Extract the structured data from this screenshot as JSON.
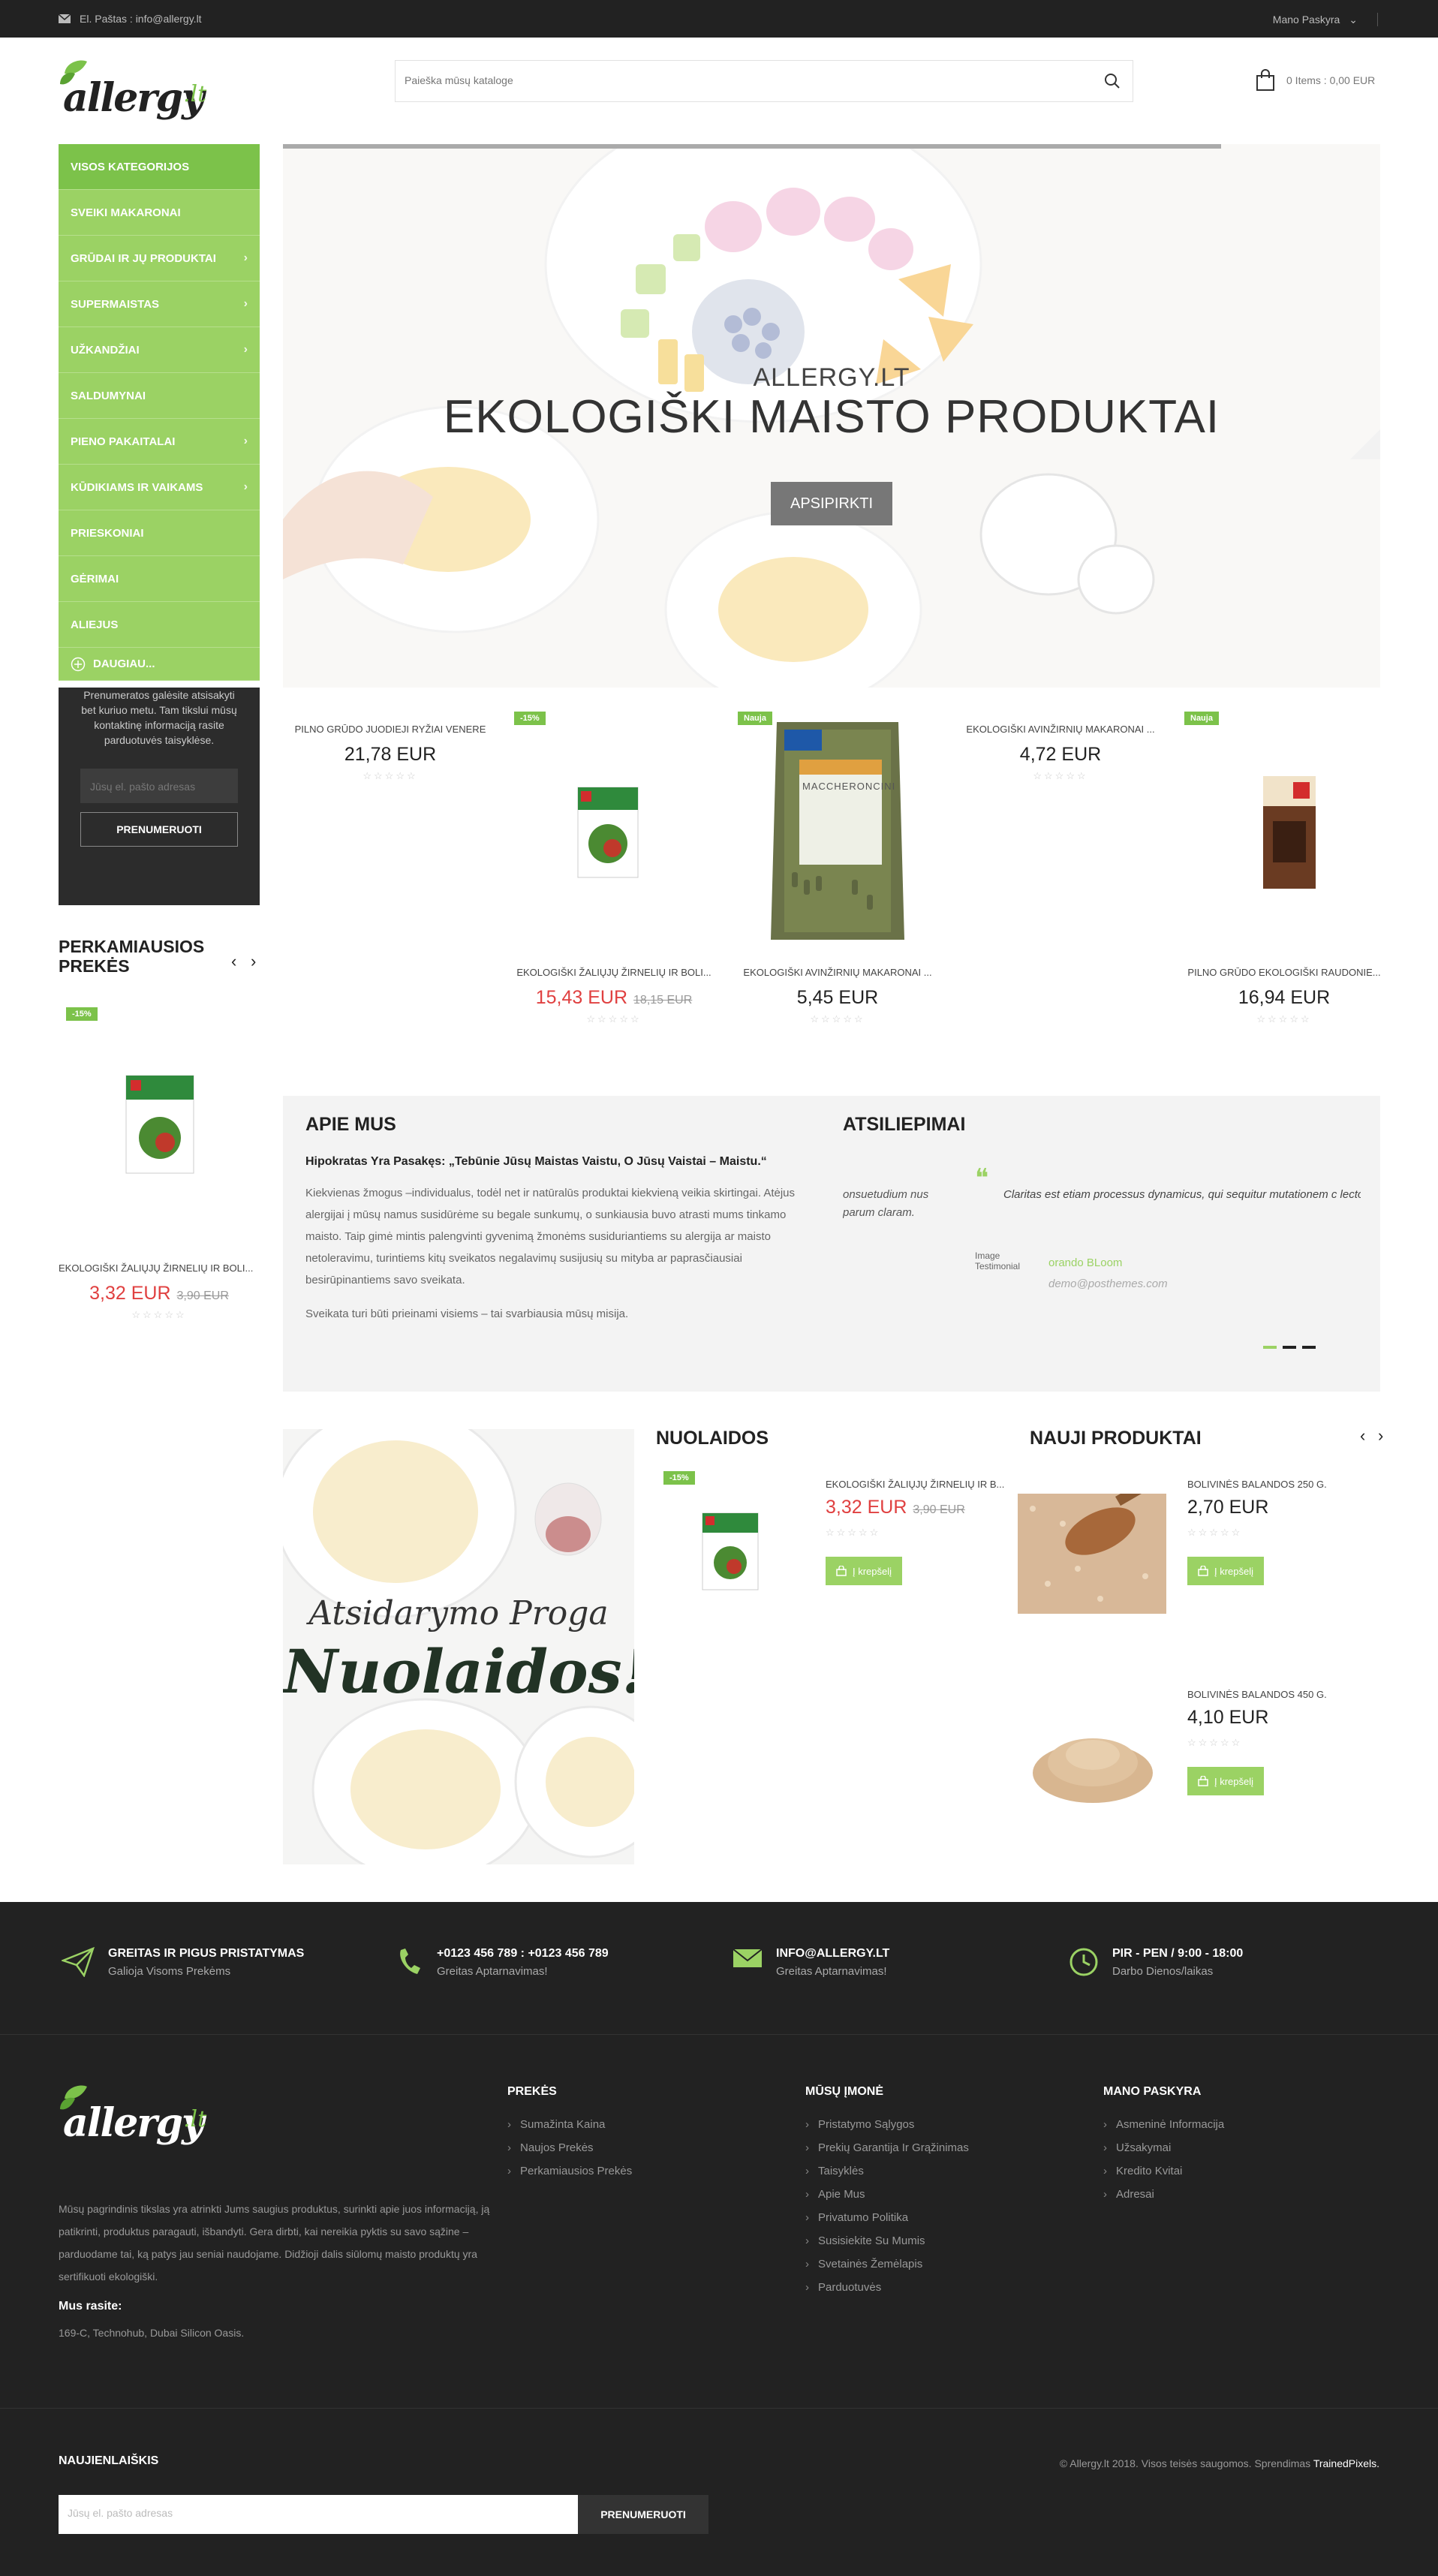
{
  "topbar": {
    "email": "El. Paštas : info@allergy.lt",
    "account": "Mano Paskyra"
  },
  "header": {
    "logo_text": "allergy",
    "logo_tld": ".lt",
    "search_placeholder": "Paieška mūsų kataloge",
    "cart": "0 Items : 0,00 EUR"
  },
  "categories": [
    "Visos kategorijos",
    "Sveiki makaronai",
    "Grūdai ir jų produktai",
    "Supermaistas",
    "Užkandžiai",
    "Saldumynai",
    "Pieno pakaitalai",
    "Kūdikiams ir vaikams",
    "Prieskoniai",
    "Gėrimai",
    "Aliejus"
  ],
  "categories_more": "Daugiau...",
  "newsletter_side": {
    "text": "Prenumeratos galėsite atsisakyti bet kuriuo metu. Tam tikslui mūsų kontaktinę informaciją rasite parduotuvės taisyklėse.",
    "placeholder": "Jūsų el. pašto adresas",
    "button": "Prenumeruoti"
  },
  "hero": {
    "subtitle": "ALLERGY.LT",
    "title": "EKOLOGIŠKI MAISTO PRODUKTAI",
    "button": "APSIPIRKTI"
  },
  "products_row": [
    {
      "name": "Pilno grūdo juodieji ryžiai Venere",
      "price": "21,78 EUR",
      "badge": "",
      "old": ""
    },
    {
      "name": "Ekologiški žaliųjų žirnelių ir boli...",
      "price": "15,43 EUR",
      "badge": "-15%",
      "old": "18,15 EUR"
    },
    {
      "name": "Ekologiški avinžirnių makaronai ...",
      "price": "5,45 EUR",
      "badge": "Nauja",
      "old": ""
    },
    {
      "name": "Ekologiški avinžirnių makaronai ...",
      "price": "4,72 EUR",
      "badge": "",
      "old": ""
    },
    {
      "name": "Pilno grūdo ekologiški raudonie...",
      "price": "16,94 EUR",
      "badge": "Nauja",
      "old": ""
    }
  ],
  "pack_text": "MACCHERONCINI",
  "best": {
    "title": "PERKAMIAUSIOS PREKĖS",
    "badge": "-15%",
    "name": "Ekologiški žaliųjų žirnelių ir boli...",
    "price": "3,32 EUR",
    "old": "3,90 EUR"
  },
  "about": {
    "title": "APIE MUS",
    "quote": "Hipokratas Yra Pasakęs: „Tebūnie Jūsų Maistas Vaistu, O Jūsų Vaistai – Maistu.“",
    "p1": "Kiekvienas žmogus –individualus, todėl net ir natūralūs produktai kiekvieną veikia skirtingai. Atėjus alergijai į mūsų namus susidūrėme su begale sunkumų, o sunkiausia buvo atrasti mums tinkamo maisto.  Taip gimė mintis palengvinti gyvenimą žmonėms susiduriantiems su alergija ar maisto netoleravimu, turintiems kitų sveikatos negalavimų susijusių su mityba ar paprasčiausiai besirūpinantiems savo sveikata.",
    "p2": "Sveikata turi būti prieinami visiems – tai svarbiausia mūsų misija."
  },
  "testimonials": {
    "title": "ATSILIEPIMAI",
    "left_text": "onsuetudium nus parum claram.",
    "text": "Claritas est etiam processus dynamicus, qui sequitur mutationem c lectorum. Mirum est notare quam littera gothica, quam nunc putar",
    "image_alt": "Image Testimonial",
    "author": "orando BLoom",
    "email": "demo@posthemes.com"
  },
  "promo": {
    "line1": "Atsidarymo Proga",
    "line2": "Nuolaidos!"
  },
  "discounts": {
    "title": "NUOLAIDOS",
    "badge": "-15%",
    "name": "Ekologiški žaliųjų žirnelių ir b...",
    "price": "3,32 EUR",
    "old": "3,90 EUR",
    "button": "Į krepšelį"
  },
  "new_products": {
    "title": "NAUJI PRODUKTAI",
    "items": [
      {
        "name": "Bolivinės balandos 250 g.",
        "price": "2,70 EUR",
        "button": "Į krepšelį"
      },
      {
        "name": "Bolivinės balandos 450 g.",
        "price": "4,10 EUR",
        "button": "Į krepšelį"
      }
    ]
  },
  "features": [
    {
      "icon": "paper-plane-icon",
      "title": "GREITAS IR PIGUS PRISTATYMAS",
      "text": "Galioja Visoms Prekėms"
    },
    {
      "icon": "phone-icon",
      "title": "+0123 456 789 : +0123 456 789",
      "text": "Greitas Aptarnavimas!"
    },
    {
      "icon": "envelope-icon",
      "title": "INFO@ALLERGY.LT",
      "text": "Greitas Aptarnavimas!"
    },
    {
      "icon": "clock-icon",
      "title": "PIR - PEN / 9:00 - 18:00",
      "text": "Darbo Dienos/laikas"
    }
  ],
  "footer": {
    "about": "Mūsų pagrindinis tikslas yra atrinkti Jums saugius produktus, surinkti apie juos informaciją, ją patikrinti, produktus paragauti, išbandyti. Gera dirbti, kai nereikia pyktis su savo sąžine – parduodame tai, ką patys jau seniai naudojame. Didžioji dalis siūlomų maisto produktų yra sertifikuoti ekologiški.",
    "find_us": "Mus rasite:",
    "address": "169-C, Technohub, Dubai Silicon Oasis.",
    "cols": [
      {
        "title": "PREKĖS",
        "items": [
          "Sumažinta Kaina",
          "Naujos Prekės",
          "Perkamiausios Prekės"
        ]
      },
      {
        "title": "MŪSŲ ĮMONĖ",
        "items": [
          "Pristatymo Sąlygos",
          "Prekių Garantija Ir Grąžinimas",
          "Taisyklės",
          "Apie Mus",
          "Privatumo Politika",
          "Susisiekite Su Mumis",
          "Svetainės Žemėlapis",
          "Parduotuvės"
        ]
      },
      {
        "title": "MANO PASKYRA",
        "items": [
          "Asmeninė Informacija",
          "Užsakymai",
          "Kredito Kvitai",
          "Adresai"
        ]
      }
    ],
    "newsletter_title": "NAUJIENLAIŠKIS",
    "newsletter_placeholder": "Jūsų el. pašto adresas",
    "newsletter_button": "PRENUMERUOTI",
    "copyright": "© Allergy.lt 2018. Visos teisės saugomos. Sprendimas",
    "credit": "TrainedPixels."
  },
  "colors": {
    "accent": "#9bd264",
    "accent_dark": "#7cc24a",
    "sale": "#e04040",
    "dark": "#222222"
  }
}
